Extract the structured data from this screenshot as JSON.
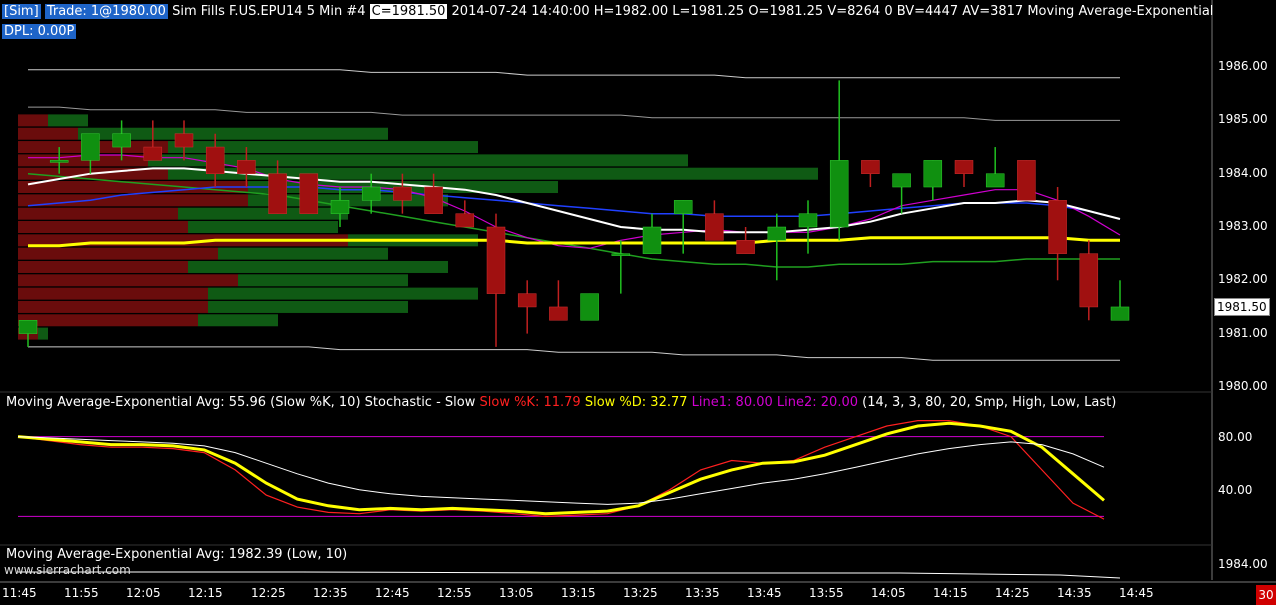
{
  "header": {
    "sim_tag": "[Sim]",
    "trade_tag": "Trade: 1@1980.00",
    "fills": "Sim Fills",
    "symbol": "F.US.EPU14",
    "interval": "5 Min",
    "chart_no": "#4",
    "close_tag": "C=1981.50",
    "bar_info": "2014-07-24 14:40:00 H=1982.00 L=1981.25 O=1981.25 V=8264 0 BV=4447 AV=3817",
    "study_name": "Moving Average-Exponential",
    "dpl": "DPL: 0.00P"
  },
  "stoch_panel": {
    "title_avg": "Moving Average-Exponential  Avg: 55.96  (Slow %K, 10)  Stochastic - Slow",
    "k_label": "Slow %K: 11.79",
    "d_label": "Slow %D: 32.77",
    "line1_label": "Line1: 80.00",
    "line2_label": "Line2: 20.00",
    "params": "(14, 3, 3, 80, 20, Smp, High, Low, Last)"
  },
  "low_panel": {
    "title": "Moving Average-Exponential  Avg: 1982.39  (Low, 10)"
  },
  "watermark": "www.sierrachart.com",
  "corner_badge": "30",
  "colors": {
    "up": "#109010",
    "down": "#a01010",
    "ema_white": "#ffffff",
    "ema_blue": "#2040ff",
    "ema_yellow": "#ffff00",
    "magenta": "#d000d0",
    "stoch_k": "#ff2020",
    "stoch_d": "#ffff00"
  },
  "price_axis": {
    "labels": [
      "1986.00",
      "1985.00",
      "1984.00",
      "1983.00",
      "1982.00",
      "1981.00",
      "1980.00"
    ],
    "last_price": "1981.50"
  },
  "stoch_axis": {
    "labels": [
      "80.00",
      "40.00"
    ]
  },
  "low_axis": {
    "labels": [
      "1984.00"
    ]
  },
  "time_axis": {
    "labels": [
      "11:45",
      "11:55",
      "12:05",
      "12:15",
      "12:25",
      "12:35",
      "12:45",
      "12:55",
      "13:05",
      "13:15",
      "13:25",
      "13:35",
      "13:45",
      "13:55",
      "14:05",
      "14:15",
      "14:25",
      "14:35",
      "14:45"
    ]
  },
  "chart_data": [
    {
      "type": "candlestick",
      "x": [
        "11:45",
        "11:50",
        "11:55",
        "12:00",
        "12:05",
        "12:10",
        "12:15",
        "12:20",
        "12:25",
        "12:30",
        "12:35",
        "12:40",
        "12:45",
        "12:50",
        "12:55",
        "13:00",
        "13:05",
        "13:10",
        "13:15",
        "13:20",
        "13:25",
        "13:30",
        "13:35",
        "13:40",
        "13:45",
        "13:50",
        "13:55",
        "14:00",
        "14:05",
        "14:10",
        "14:15",
        "14:20",
        "14:25",
        "14:30",
        "14:35",
        "14:40"
      ],
      "open": [
        1981.0,
        1984.25,
        1984.25,
        1984.5,
        1984.5,
        1984.75,
        1984.5,
        1984.25,
        1984.0,
        1984.0,
        1983.25,
        1983.5,
        1983.75,
        1983.75,
        1983.25,
        1983.0,
        1981.75,
        1981.5,
        1981.25,
        1982.5,
        1982.5,
        1983.25,
        1983.25,
        1982.75,
        1982.75,
        1983.0,
        1983.0,
        1984.25,
        1983.75,
        1983.75,
        1984.25,
        1983.75,
        1984.25,
        1983.5,
        1982.5,
        1981.25
      ],
      "high": [
        1981.25,
        1984.5,
        1984.75,
        1985.0,
        1985.0,
        1985.0,
        1984.75,
        1984.5,
        1984.25,
        1984.0,
        1983.75,
        1984.0,
        1984.0,
        1984.0,
        1983.5,
        1983.25,
        1982.0,
        1982.0,
        1981.75,
        1982.75,
        1983.25,
        1983.5,
        1983.5,
        1983.0,
        1983.25,
        1983.5,
        1985.75,
        1984.25,
        1984.0,
        1984.25,
        1984.25,
        1984.5,
        1984.25,
        1983.75,
        1982.75,
        1982.0
      ],
      "low": [
        1980.75,
        1984.0,
        1984.0,
        1984.25,
        1984.25,
        1984.25,
        1983.75,
        1983.75,
        1983.25,
        1983.25,
        1983.0,
        1983.25,
        1983.25,
        1983.25,
        1983.0,
        1980.75,
        1981.0,
        1981.25,
        1981.25,
        1981.75,
        1982.5,
        1982.5,
        1982.75,
        1982.5,
        1982.0,
        1982.5,
        1982.75,
        1983.75,
        1983.25,
        1983.5,
        1983.75,
        1983.75,
        1983.5,
        1982.0,
        1981.25,
        1981.25
      ],
      "close": [
        1981.25,
        1984.25,
        1984.75,
        1984.75,
        1984.25,
        1984.5,
        1984.0,
        1984.0,
        1983.25,
        1983.25,
        1983.5,
        1983.75,
        1983.5,
        1983.25,
        1983.0,
        1981.75,
        1981.5,
        1981.25,
        1981.75,
        1982.5,
        1983.0,
        1983.5,
        1982.75,
        1982.5,
        1983.0,
        1983.25,
        1984.25,
        1984.0,
        1984.0,
        1984.25,
        1984.0,
        1984.0,
        1983.5,
        1982.5,
        1981.5,
        1981.5
      ],
      "ema_white": [
        1983.8,
        1983.9,
        1984.0,
        1984.05,
        1984.1,
        1984.1,
        1984.05,
        1984.0,
        1983.95,
        1983.9,
        1983.85,
        1983.85,
        1983.8,
        1983.75,
        1983.7,
        1983.6,
        1983.45,
        1983.3,
        1983.15,
        1983.0,
        1982.95,
        1982.95,
        1982.9,
        1982.9,
        1982.9,
        1982.95,
        1983.0,
        1983.1,
        1983.25,
        1983.35,
        1983.45,
        1983.45,
        1983.5,
        1983.45,
        1983.3,
        1983.15
      ],
      "ema_blue": [
        1983.4,
        1983.45,
        1983.5,
        1983.6,
        1983.65,
        1983.7,
        1983.75,
        1983.75,
        1983.75,
        1983.75,
        1983.7,
        1983.7,
        1983.65,
        1983.6,
        1983.55,
        1983.5,
        1983.45,
        1983.4,
        1983.35,
        1983.3,
        1983.25,
        1983.25,
        1983.2,
        1983.2,
        1983.2,
        1983.2,
        1983.25,
        1983.3,
        1983.35,
        1983.4,
        1983.45,
        1983.45,
        1983.45,
        1983.4,
        1983.3,
        1983.15
      ],
      "ema_yellow": [
        1982.65,
        1982.65,
        1982.7,
        1982.7,
        1982.7,
        1982.7,
        1982.75,
        1982.75,
        1982.75,
        1982.75,
        1982.75,
        1982.75,
        1982.75,
        1982.75,
        1982.75,
        1982.75,
        1982.7,
        1982.7,
        1982.7,
        1982.7,
        1982.7,
        1982.7,
        1982.7,
        1982.7,
        1982.75,
        1982.75,
        1982.75,
        1982.8,
        1982.8,
        1982.8,
        1982.8,
        1982.8,
        1982.8,
        1982.8,
        1982.75,
        1982.75
      ],
      "magenta": [
        1984.3,
        1984.3,
        1984.35,
        1984.35,
        1984.3,
        1984.3,
        1984.2,
        1984.1,
        1983.9,
        1983.8,
        1983.75,
        1983.75,
        1983.7,
        1983.55,
        1983.3,
        1983.0,
        1982.8,
        1982.65,
        1982.6,
        1982.75,
        1982.85,
        1982.9,
        1982.95,
        1982.9,
        1982.9,
        1982.9,
        1983.0,
        1983.15,
        1983.4,
        1983.5,
        1983.6,
        1983.7,
        1983.7,
        1983.5,
        1983.2,
        1982.85
      ],
      "green_ma": [
        1984.0,
        1983.95,
        1983.9,
        1983.85,
        1983.8,
        1983.75,
        1983.7,
        1983.65,
        1983.6,
        1983.5,
        1983.4,
        1983.3,
        1983.2,
        1983.1,
        1983.0,
        1982.9,
        1982.8,
        1982.7,
        1982.6,
        1982.5,
        1982.4,
        1982.35,
        1982.3,
        1982.3,
        1982.25,
        1982.25,
        1982.3,
        1982.3,
        1982.3,
        1982.35,
        1982.35,
        1982.35,
        1982.4,
        1982.4,
        1982.4,
        1982.4
      ],
      "upper_band": [
        1985.95,
        1985.95,
        1985.95,
        1985.95,
        1985.95,
        1985.95,
        1985.95,
        1985.95,
        1985.95,
        1985.95,
        1985.95,
        1985.9,
        1985.9,
        1985.9,
        1985.9,
        1985.9,
        1985.85,
        1985.85,
        1985.85,
        1985.85,
        1985.85,
        1985.85,
        1985.85,
        1985.8,
        1985.8,
        1985.8,
        1985.8,
        1985.8,
        1985.8,
        1985.8,
        1985.8,
        1985.8,
        1985.8,
        1985.8,
        1985.8,
        1985.8
      ],
      "upper_band2": [
        1985.25,
        1985.25,
        1985.2,
        1985.2,
        1985.2,
        1985.2,
        1985.2,
        1985.15,
        1985.15,
        1985.15,
        1985.15,
        1985.15,
        1985.1,
        1985.1,
        1985.1,
        1985.1,
        1985.1,
        1985.1,
        1985.1,
        1985.1,
        1985.05,
        1985.05,
        1985.05,
        1985.05,
        1985.05,
        1985.05,
        1985.05,
        1985.05,
        1985.05,
        1985.05,
        1985.05,
        1985.0,
        1985.0,
        1985.0,
        1985.0,
        1985.0
      ],
      "lower_band": [
        1980.75,
        1980.75,
        1980.75,
        1980.75,
        1980.75,
        1980.75,
        1980.75,
        1980.75,
        1980.75,
        1980.75,
        1980.7,
        1980.7,
        1980.7,
        1980.7,
        1980.7,
        1980.7,
        1980.7,
        1980.65,
        1980.65,
        1980.65,
        1980.65,
        1980.6,
        1980.6,
        1980.6,
        1980.6,
        1980.55,
        1980.55,
        1980.55,
        1980.55,
        1980.5,
        1980.5,
        1980.5,
        1980.5,
        1980.5,
        1980.5,
        1980.5
      ],
      "volume_profile": {
        "prices": [
          1985.0,
          1984.75,
          1984.5,
          1984.25,
          1984.0,
          1983.75,
          1983.5,
          1983.25,
          1983.0,
          1982.75,
          1982.5,
          1982.25,
          1982.0,
          1981.75,
          1981.5,
          1981.25,
          1981.0
        ],
        "bid": [
          30,
          60,
          150,
          130,
          150,
          230,
          230,
          160,
          170,
          330,
          200,
          170,
          220,
          190,
          190,
          180,
          20
        ],
        "ask": [
          40,
          310,
          310,
          540,
          650,
          310,
          200,
          170,
          150,
          130,
          170,
          260,
          170,
          270,
          200,
          80,
          10
        ]
      },
      "ylim": [
        1979.75,
        1986.5
      ]
    },
    {
      "type": "line",
      "series": [
        {
          "name": "Slow %K",
          "values": [
            80,
            77,
            74,
            72,
            72,
            71,
            68,
            55,
            36,
            27,
            23,
            22,
            25,
            24,
            25,
            24,
            22,
            20,
            21,
            22,
            28,
            40,
            55,
            62,
            60,
            62,
            72,
            80,
            88,
            92,
            92,
            88,
            80,
            55,
            30,
            18
          ]
        },
        {
          "name": "Slow %D",
          "values": [
            80,
            78,
            76,
            74,
            74,
            73,
            70,
            60,
            45,
            33,
            28,
            25,
            26,
            25,
            26,
            25,
            24,
            22,
            23,
            24,
            28,
            38,
            48,
            55,
            60,
            61,
            66,
            74,
            82,
            88,
            90,
            88,
            84,
            72,
            52,
            32
          ]
        },
        {
          "name": "Avg",
          "values": [
            80,
            79,
            78,
            77,
            76,
            75,
            73,
            68,
            60,
            52,
            45,
            40,
            37,
            35,
            34,
            33,
            32,
            31,
            30,
            29,
            30,
            33,
            37,
            41,
            45,
            48,
            52,
            57,
            62,
            67,
            71,
            74,
            76,
            74,
            67,
            57
          ]
        },
        {
          "name": "Line1",
          "values": [
            80
          ]
        },
        {
          "name": "Line2",
          "values": [
            20
          ]
        }
      ],
      "ylim": [
        0,
        100
      ]
    }
  ]
}
